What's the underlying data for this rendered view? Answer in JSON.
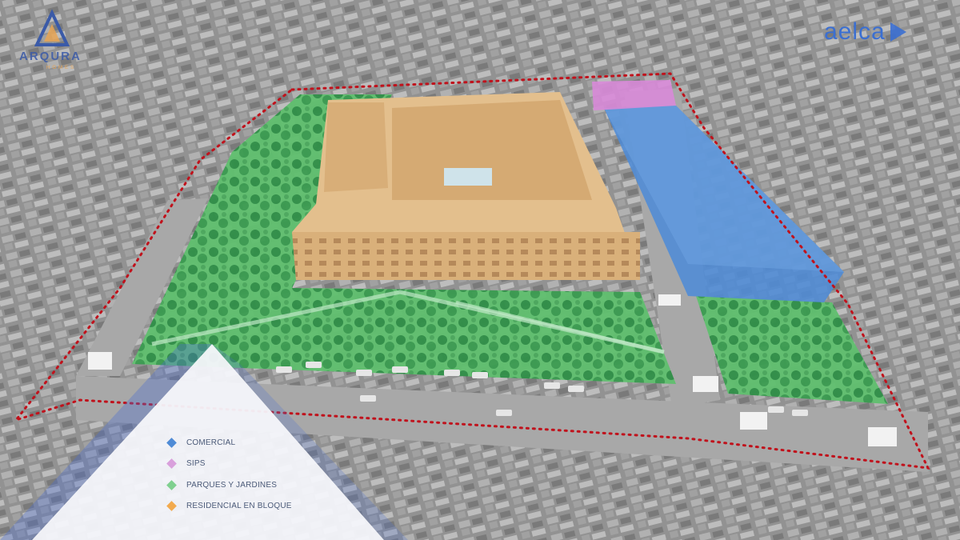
{
  "brand_left": {
    "name": "ARQURA",
    "tagline": "HOMES",
    "icon": "arqura-a-logo"
  },
  "brand_right": {
    "name": "aelca",
    "icon": "play-triangle-logo",
    "color": "#3b6fd1"
  },
  "legend": {
    "items": [
      {
        "label": "COMERCIAL",
        "color": "#4f8bd6"
      },
      {
        "label": "SIPS",
        "color": "#d9a0dc"
      },
      {
        "label": "PARQUES Y JARDINES",
        "color": "#7fd08f"
      },
      {
        "label": "RESIDENCIAL EN BLOQUE",
        "color": "#f2aa4e"
      }
    ]
  },
  "zones": {
    "comercial": "#4f8bd6",
    "sips": "#d889d8",
    "parques": "#5ec26f",
    "residencial": "#d9a56a",
    "boundary": "#c0121c"
  }
}
